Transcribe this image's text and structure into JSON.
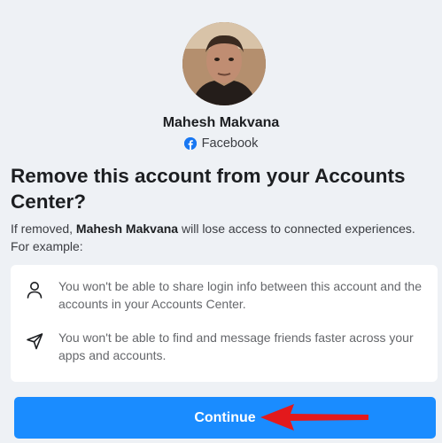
{
  "profile": {
    "name": "Mahesh Makvana",
    "source": "Facebook",
    "source_icon": "facebook-icon",
    "avatar": "profile-photo"
  },
  "dialog": {
    "title": "Remove this account from your Accounts Center?",
    "description_prefix": "If removed, ",
    "description_name": "Mahesh Makvana",
    "description_suffix": " will lose access to connected experiences. For example:"
  },
  "consequences": [
    {
      "icon": "person-icon",
      "text": "You won't be able to share login info between this account and the accounts in your Accounts Center."
    },
    {
      "icon": "send-icon",
      "text": "You won't be able to find and message friends faster across your apps and accounts."
    }
  ],
  "actions": {
    "continue_label": "Continue"
  },
  "colors": {
    "background": "#eef1f5",
    "primary_button": "#1a8cff",
    "facebook_blue": "#1877f2",
    "annotation_arrow": "#e3191c"
  }
}
